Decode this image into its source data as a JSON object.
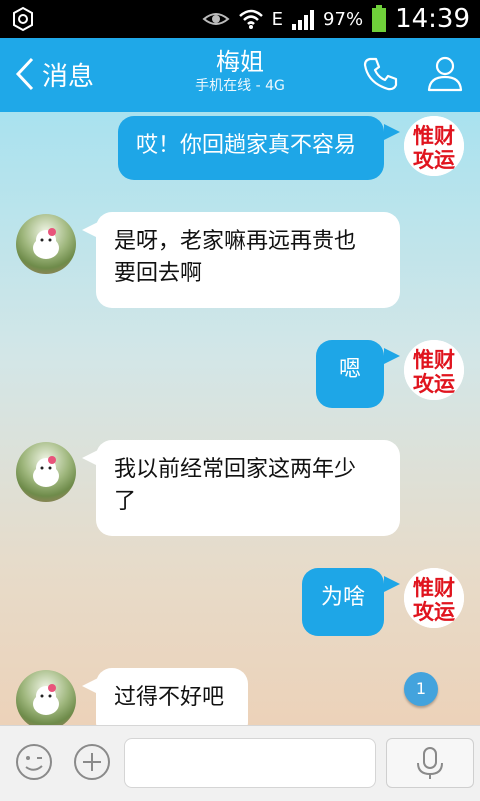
{
  "status_bar": {
    "network_label": "E",
    "battery": "97%",
    "time": "14:39"
  },
  "header": {
    "back_label": "消息",
    "title": "梅姐",
    "subtitle": "手机在线 - 4G"
  },
  "messages": [
    {
      "side": "out",
      "text": "哎！你回趟家真不容易"
    },
    {
      "side": "in",
      "text_lines": [
        "是呀，老家嘛再远再贵也",
        "要回去啊"
      ]
    },
    {
      "side": "out",
      "text": "嗯"
    },
    {
      "side": "in",
      "text_lines": [
        "我以前经常回家这两年少",
        "了"
      ]
    },
    {
      "side": "out",
      "text": "为啥"
    },
    {
      "side": "in",
      "text": "过得不好吧"
    }
  ],
  "unread_count": "1",
  "seal_text": [
    "惟财",
    "攻运"
  ],
  "colors": {
    "header_bg": "#1fa8e8",
    "outgoing_bubble": "#1ea6e7",
    "incoming_bubble": "#ffffff",
    "seal_red": "#e0141e"
  },
  "icons": {
    "back": "chevron-left-icon",
    "call": "phone-icon",
    "profile": "user-icon",
    "emoji": "emoji-icon",
    "plus": "plus-icon",
    "voice": "microphone-icon"
  }
}
